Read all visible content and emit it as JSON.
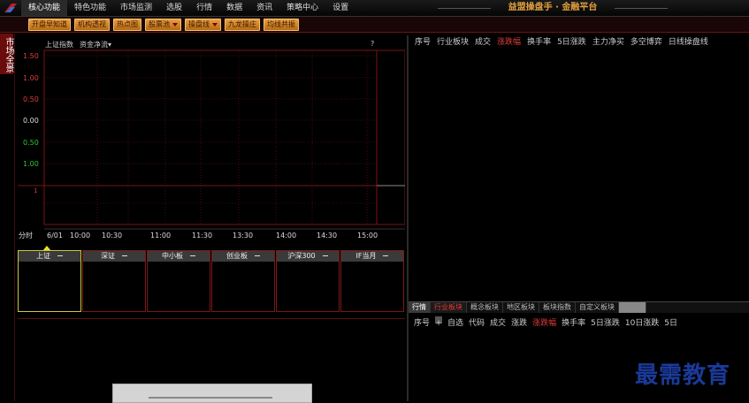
{
  "menu": {
    "items": [
      "核心功能",
      "特色功能",
      "市场监测",
      "选股",
      "行情",
      "数据",
      "资讯",
      "策略中心",
      "设置"
    ],
    "active_index": 0
  },
  "app_title": "益盟操盘手 · 金融平台",
  "toolbar": {
    "buttons": [
      "开盘早知道",
      "机构透视",
      "热点图",
      "股票池",
      "操盘线",
      "九龙操庄",
      "均线共振"
    ],
    "dropdown_flags": [
      false,
      false,
      false,
      true,
      true,
      false,
      false
    ]
  },
  "side_tab": "市场全景",
  "chart": {
    "index_label": "上证指数",
    "metric_label": "资金净流▾",
    "help": "?",
    "mode_label": "分时",
    "date_label": "6/01",
    "chart_data": {
      "type": "line",
      "y_ticks": [
        "1.50",
        "1.00",
        "0.50",
        "0.00",
        "0.50",
        "1.00"
      ],
      "y_tick_colors": [
        "#e03c3c",
        "#e03c3c",
        "#e03c3c",
        "#dddddd",
        "#2ec82e",
        "#2ec82e"
      ],
      "x_ticks": [
        "10:00",
        "10:30",
        "11:00",
        "11:30",
        "13:30",
        "14:00",
        "14:30",
        "15:00"
      ],
      "series": []
    }
  },
  "tiles": [
    {
      "label": "上证",
      "selected": true
    },
    {
      "label": "深证",
      "selected": false
    },
    {
      "label": "中小板",
      "selected": false
    },
    {
      "label": "创业板",
      "selected": false
    },
    {
      "label": "沪深300",
      "selected": false
    },
    {
      "label": "IF当月",
      "selected": false
    }
  ],
  "sector_table": {
    "columns": [
      "序号",
      "行业板块",
      "成交",
      "涨跌幅",
      "换手率",
      "5日涨跌",
      "主力净买",
      "多空博弈",
      "日线操盘线"
    ],
    "highlight_index": 3
  },
  "sector_tabs": [
    "行情",
    "行业板块",
    "概念板块",
    "地区板块",
    "板块指数",
    "自定义板块"
  ],
  "stock_table": {
    "plus": "+",
    "columns": [
      "序号",
      "自选",
      "代码",
      "成交",
      "涨跌",
      "涨跌幅",
      "换手率",
      "5日涨跌",
      "10日涨跌",
      "5日"
    ],
    "highlight_index": 5
  },
  "watermark": "最需教育",
  "colors": {
    "up": "#e03c3c",
    "down": "#2ec82e",
    "grid": "#7a1414",
    "accent": "#e6a040"
  }
}
